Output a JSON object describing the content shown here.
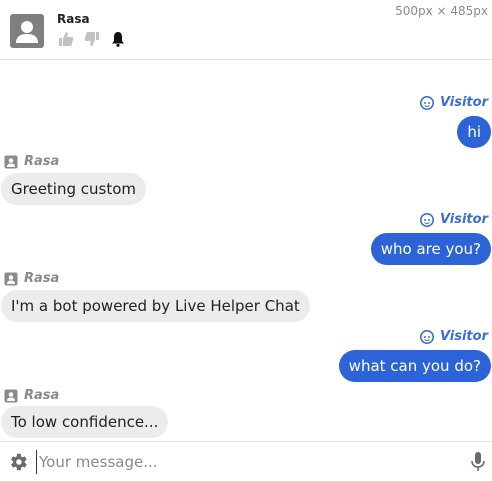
{
  "viewport_label": "500px × 485px",
  "header": {
    "operator_name": "Rasa",
    "icons": [
      "avatar-icon",
      "thumbs-up-icon",
      "thumbs-down-icon",
      "bell-icon"
    ]
  },
  "messages": [
    {
      "sender": "Visitor",
      "text": "hi"
    },
    {
      "sender": "Rasa",
      "text": "Greeting custom"
    },
    {
      "sender": "Visitor",
      "text": "who are you?"
    },
    {
      "sender": "Rasa",
      "text": "I'm a bot powered by Live Helper Chat"
    },
    {
      "sender": "Visitor",
      "text": "what can you do?"
    },
    {
      "sender": "Rasa",
      "text": "To low confidence..."
    }
  ],
  "footer": {
    "placeholder": "Your message...",
    "icons": [
      "gear-icon",
      "microphone-icon"
    ]
  },
  "colors": {
    "visitor_bubble": "#2c64d8",
    "visitor_name": "#3b6fd6",
    "bot_bubble": "#ececec",
    "bot_name": "#8a8a8a"
  }
}
